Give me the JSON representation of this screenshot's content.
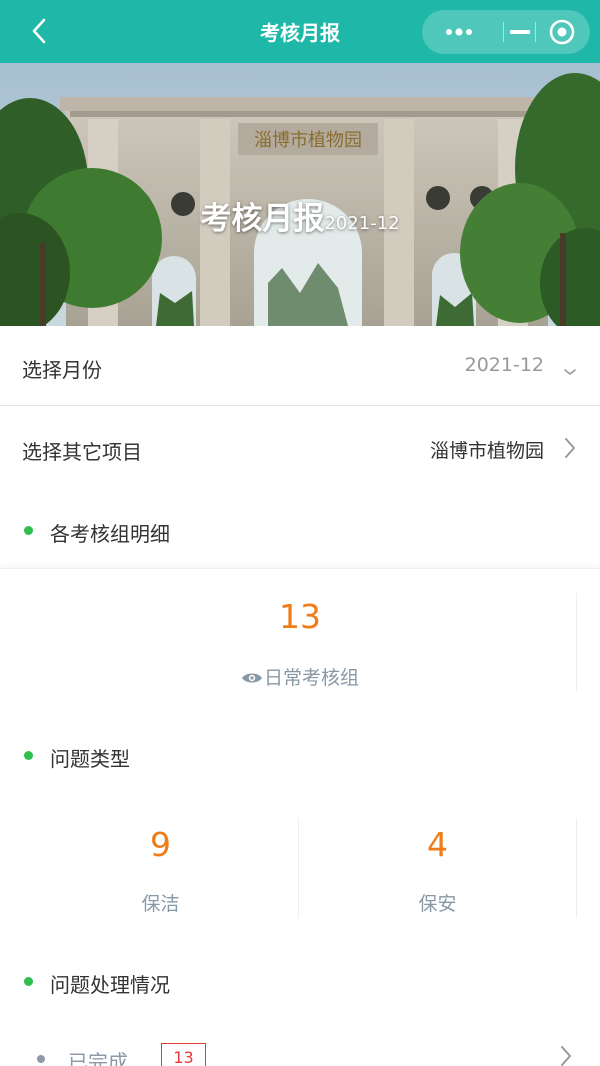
{
  "titlebar": {
    "title": "考核月报",
    "background": "#1fb8a8",
    "icons": [
      "back-arrow-icon",
      "more-dots-icon",
      "minimize-icon",
      "close-target-icon"
    ]
  },
  "banner": {
    "caption_title": "考核月报",
    "caption_date": "2021-12",
    "gate_inscription": "淄博市植物园"
  },
  "month_row": {
    "label": "选择月份",
    "value": "2021-12"
  },
  "project_row": {
    "label": "选择其它项目",
    "value": "淄博市植物园"
  },
  "sections": {
    "groups": "各考核组明细",
    "problem_types": "问题类型",
    "handling": "问题处理情况"
  },
  "group_stats": [
    {
      "count": "13",
      "label": "日常考核组"
    }
  ],
  "problem_stats": [
    {
      "count": "9",
      "label": "保洁"
    },
    {
      "count": "4",
      "label": "保安"
    }
  ],
  "handling": {
    "completed_label": "已完成",
    "completed_count": "13"
  },
  "colors": {
    "accent": "#1fb8a8",
    "number": "#ef7c17",
    "dot": "#2ebf4d",
    "badge": "#e53935"
  }
}
